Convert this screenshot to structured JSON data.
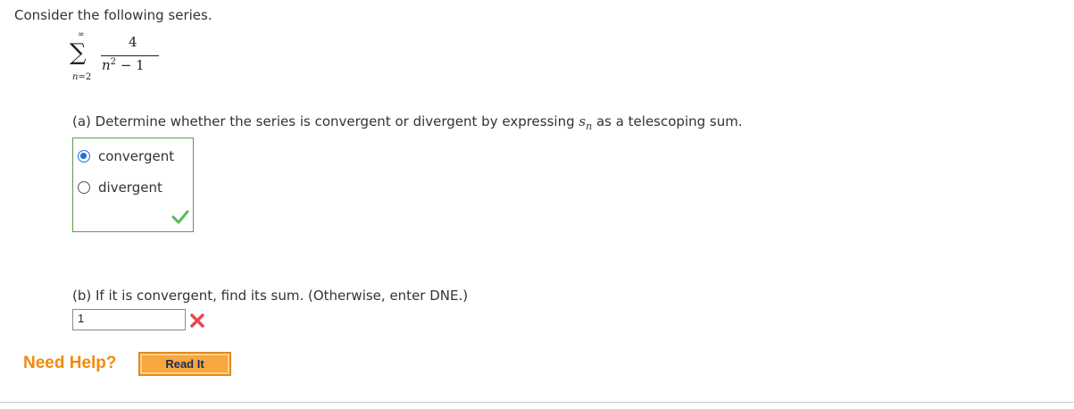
{
  "intro": "Consider the following series.",
  "series": {
    "sigma": "∑",
    "upper": "∞",
    "lower_var": "n",
    "lower_eq": "=2",
    "numerator": "4",
    "denominator_var": "n",
    "denominator_exp": "2",
    "denominator_rest": " − 1"
  },
  "part_a": {
    "text_before": "(a) Determine whether the series is convergent or divergent by expressing ",
    "math_var": "s",
    "math_sub": "n",
    "text_after": " as a telescoping sum.",
    "options": [
      {
        "label": "convergent",
        "selected": true
      },
      {
        "label": "divergent",
        "selected": false
      }
    ],
    "status": "correct"
  },
  "part_b": {
    "question": "(b) If it is convergent, find its sum. (Otherwise, enter DNE.)",
    "answer_value": "1",
    "status": "incorrect"
  },
  "help": {
    "label": "Need Help?",
    "button_label": "Read It"
  },
  "colors": {
    "correct": "#5cb85c",
    "incorrect": "#e8484d",
    "help_text": "#f08a0c",
    "button_bg": "#f9a63f",
    "radio_selected": "#1f6fd6"
  }
}
